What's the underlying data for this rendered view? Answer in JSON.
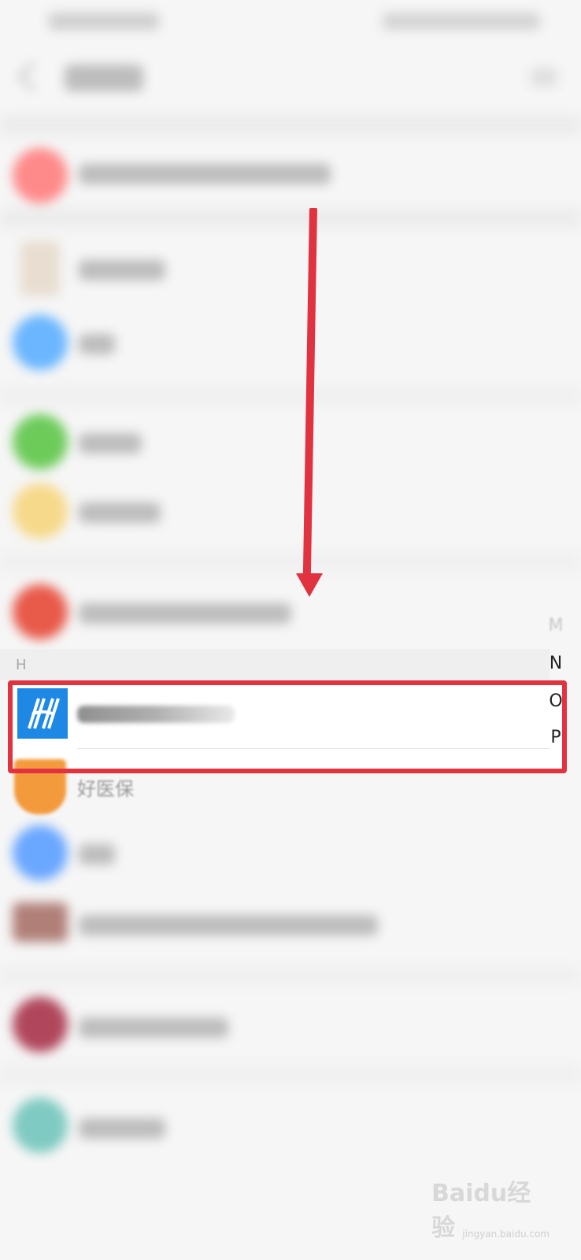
{
  "section": {
    "letter": "H"
  },
  "highlighted_app": {
    "icon": "hanting-h-icon",
    "icon_color": "#1e88e5"
  },
  "next_app": {
    "name": "好医保",
    "icon_color": "#f39a3c"
  },
  "index_bar": [
    "M",
    "N",
    "O",
    "P"
  ],
  "annotation": {
    "color": "#e0323f"
  },
  "watermark": {
    "text": "Baidu经验",
    "sub": "jingyan.baidu.com"
  }
}
